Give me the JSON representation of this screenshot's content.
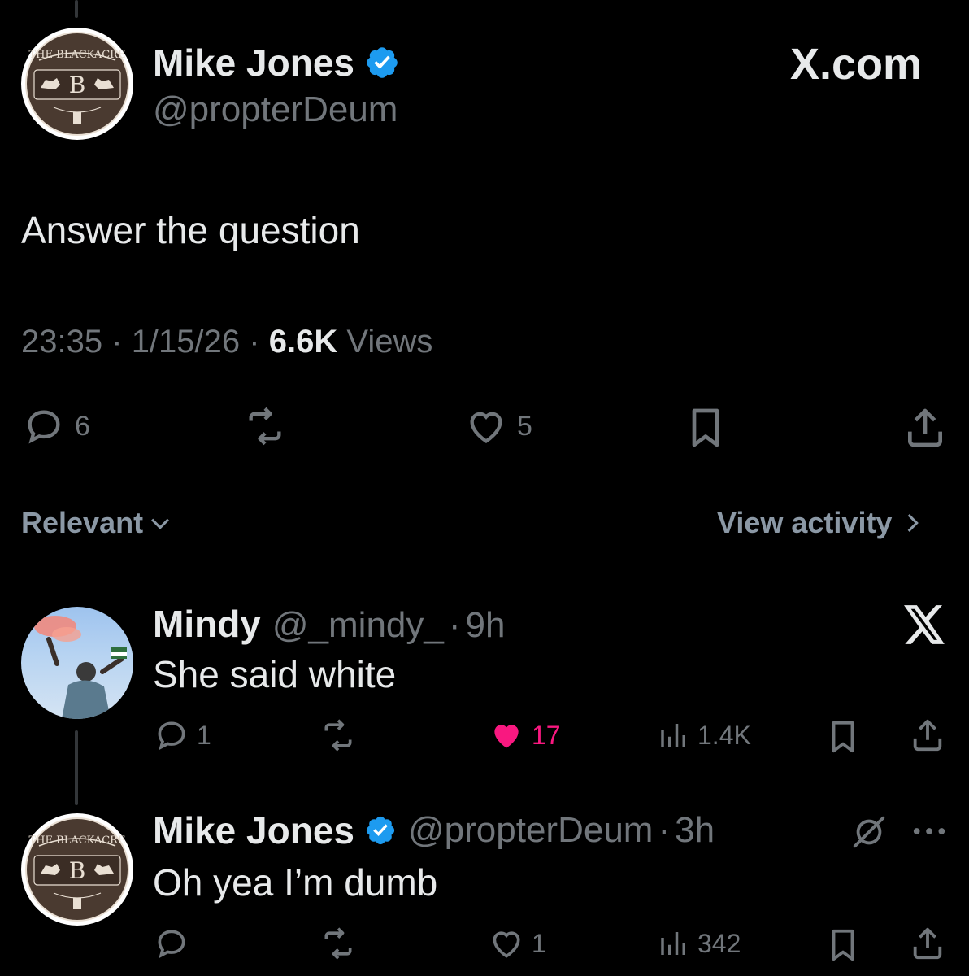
{
  "brand": {
    "label": "X.com"
  },
  "main_tweet": {
    "author_name": "Mike Jones",
    "author_handle": "@propterDeum",
    "avatar_logo_text": "THE BLACKACRE",
    "text": "Answer the question",
    "time": "23:35",
    "date": "1/15/26",
    "views_count": "6.6K",
    "views_label": "Views",
    "sep": "·",
    "actions": {
      "reply_count": "6",
      "repost_count": "",
      "like_count": "5"
    }
  },
  "sort_bar": {
    "relevant_label": "Relevant",
    "view_activity_label": "View activity"
  },
  "replies": [
    {
      "author_name": "Mindy",
      "author_handle": "@_mindy_",
      "time": "9h",
      "sep": "·",
      "text": "She said white",
      "reply_count": "1",
      "like_count": "17",
      "liked": true,
      "views_count": "1.4K"
    },
    {
      "author_name": "Mike Jones",
      "author_handle": "@propterDeum",
      "time": "3h",
      "sep": "·",
      "text": "Oh yea I’m dumb",
      "reply_count": "",
      "like_count": "1",
      "liked": false,
      "views_count": "342"
    }
  ],
  "colors": {
    "background": "#000000",
    "text_primary": "#e7e9ea",
    "text_secondary": "#71767b",
    "verified_blue": "#1d9bf0",
    "like_pink": "#f91880"
  },
  "icons": [
    "verified-badge-icon",
    "reply-icon",
    "repost-icon",
    "like-icon",
    "bookmark-icon",
    "share-icon",
    "views-icon",
    "chevron-down-icon",
    "chevron-right-icon",
    "x-logo-icon",
    "grok-icon",
    "more-icon"
  ]
}
